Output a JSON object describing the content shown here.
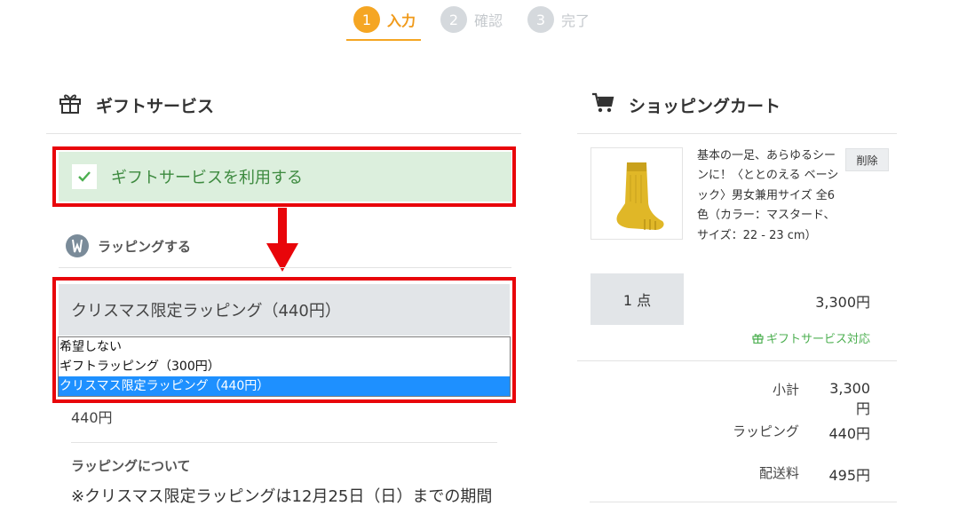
{
  "stepper": {
    "steps": [
      {
        "num": "1",
        "label": "入力"
      },
      {
        "num": "2",
        "label": "確認"
      },
      {
        "num": "3",
        "label": "完了"
      }
    ]
  },
  "gift": {
    "title": "ギフトサービス",
    "checkbox_label": "ギフトサービスを利用する",
    "wrapping_title": "ラッピングする",
    "selected_option": "クリスマス限定ラッピング（440円）",
    "options": [
      "希望しない",
      "ギフトラッピング（300円）",
      "クリスマス限定ラッピング（440円）"
    ],
    "price": "440円",
    "about_title": "ラッピングについて",
    "about_text": "※クリスマス限定ラッピングは12月25日（日）までの期間"
  },
  "cart": {
    "title": "ショッピングカート",
    "product_name": "基本の一足、あらゆるシーンに！〈ととのえる ベーシック〉男女兼用サイズ 全6色（カラー：マスタード、サイズ：22 - 23 cm）",
    "delete_label": "削除",
    "quantity": "1 点",
    "item_price": "3,300円",
    "gift_supported": "ギフトサービス対応",
    "subtotal_label": "小計",
    "subtotal_value": "3,300円",
    "wrapping_label": "ラッピング",
    "wrapping_value": "440円",
    "shipping_label": "配送料",
    "shipping_value": "495円"
  },
  "colors": {
    "accent": "#f5a623",
    "gift_green": "#4caf50",
    "highlight_red": "#e8050a",
    "selected_option": "#1e90ff"
  }
}
